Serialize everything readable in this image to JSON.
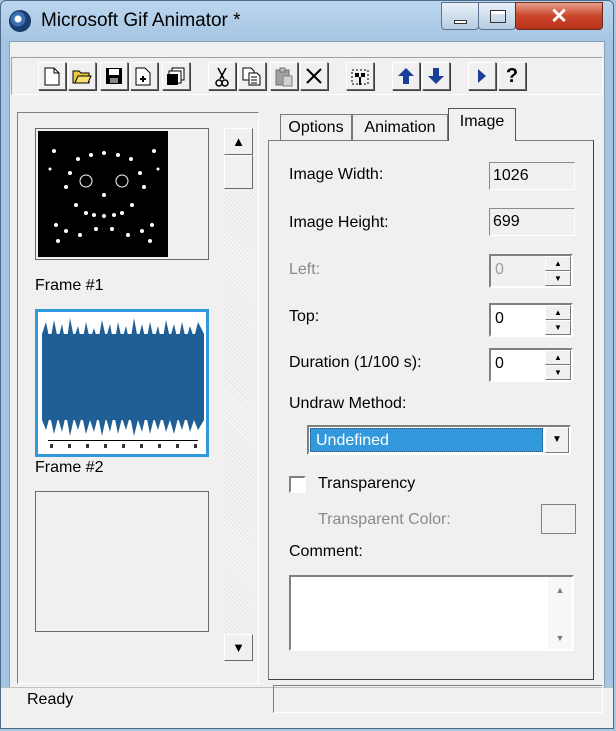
{
  "window": {
    "title": "Microsoft Gif Animator *"
  },
  "toolbar": {
    "tools": [
      {
        "name": "new-icon"
      },
      {
        "name": "open-icon"
      },
      {
        "name": "save-icon"
      },
      {
        "name": "insert-icon"
      },
      {
        "name": "save-as-icon"
      },
      {
        "name": "cut-icon"
      },
      {
        "name": "copy-icon"
      },
      {
        "name": "paste-icon"
      },
      {
        "name": "delete-icon"
      },
      {
        "name": "select-all-icon"
      },
      {
        "name": "move-up-icon"
      },
      {
        "name": "move-down-icon"
      },
      {
        "name": "preview-icon"
      },
      {
        "name": "help-icon",
        "label": "?"
      }
    ]
  },
  "frames": [
    {
      "label": "Frame #1",
      "selected": false
    },
    {
      "label": "Frame #2",
      "selected": true
    },
    {
      "label": "",
      "selected": false
    }
  ],
  "tabs": [
    {
      "label": "Options",
      "active": false
    },
    {
      "label": "Animation",
      "active": false
    },
    {
      "label": "Image",
      "active": true
    }
  ],
  "image_tab": {
    "image_width_label": "Image Width:",
    "image_width_value": "1026",
    "image_height_label": "Image Height:",
    "image_height_value": "699",
    "left_label": "Left:",
    "left_value": "0",
    "top_label": "Top:",
    "top_value": "0",
    "duration_label": "Duration (1/100 s):",
    "duration_value": "0",
    "undraw_label": "Undraw Method:",
    "undraw_value": "Undefined",
    "transparency_label": "Transparency",
    "transparency_checked": false,
    "transparent_color_label": "Transparent Color:",
    "comment_label": "Comment:",
    "comment_value": ""
  },
  "status": {
    "text": "Ready"
  }
}
